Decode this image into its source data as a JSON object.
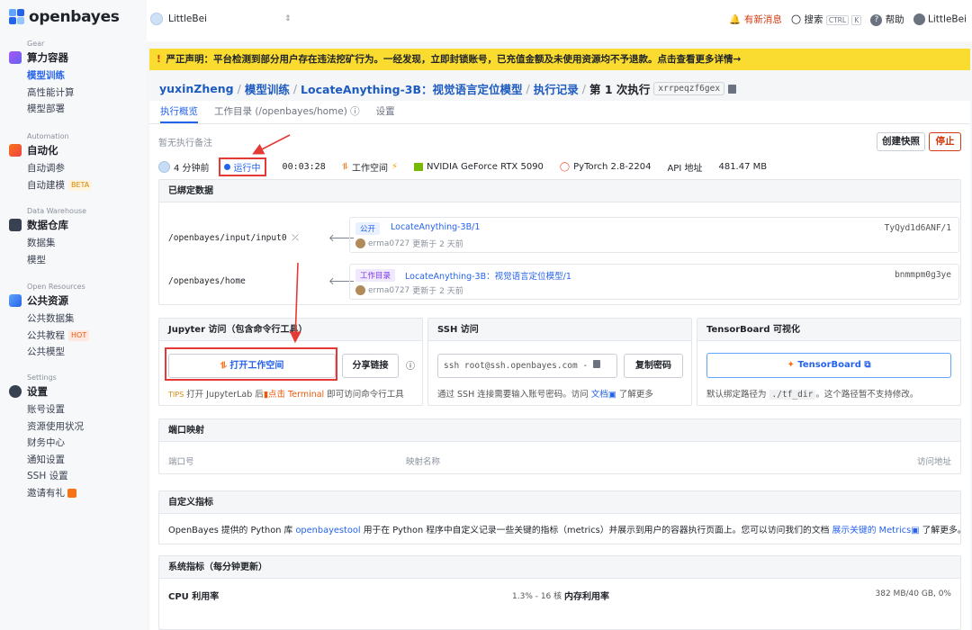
{
  "brand": {
    "name": "openbayes"
  },
  "sidebar": {
    "groups": [
      {
        "caption": "Gear",
        "title": "算力容器",
        "items": [
          "模型训练",
          "高性能计算",
          "模型部署"
        ]
      },
      {
        "caption": "Automation",
        "title": "自动化",
        "items": [
          "自动调参",
          "自动建模"
        ],
        "tag": "BETA"
      },
      {
        "caption": "Data Warehouse",
        "title": "数据仓库",
        "items": [
          "数据集",
          "模型"
        ]
      },
      {
        "caption": "Open Resources",
        "title": "公共资源",
        "items": [
          "公共数据集",
          "公共教程",
          "公共模型"
        ],
        "tag": "HOT"
      },
      {
        "caption": "Settings",
        "title": "设置",
        "items": [
          "账号设置",
          "资源使用状况",
          "财务中心",
          "通知设置",
          "SSH 设置",
          "邀请有礼"
        ]
      }
    ]
  },
  "topbar": {
    "workspace": "LittleBei",
    "news": "有新消息",
    "search": "搜索",
    "kbd_ctrl": "CTRL",
    "kbd_k": "K",
    "help": "帮助",
    "user": "LittleBei"
  },
  "banner": {
    "bang": "!",
    "text": "严正声明：平台检测到部分用户存在违法挖矿行为。一经发现，立即封锁账号，已充值金额及未使用资源均不予退款。点击查看更多详情→"
  },
  "breadcrumb": {
    "user": "yuxinZheng",
    "section": "模型训练",
    "project": "LocateAnything-3B：视觉语言定位模型",
    "records": "执行记录",
    "run": "第 1 次执行",
    "run_id": "xrrpeqzf6gex",
    "sep": "/"
  },
  "tabs": [
    "执行概览",
    "工作目录 (/openbayes/home) ⓘ",
    "设置"
  ],
  "overview": {
    "note": "暂无执行备注",
    "snapshot_btn": "创建快照",
    "stop_btn": "停止",
    "time_ago": "4 分钟前",
    "status": "运行中",
    "duration": "00:03:28",
    "workspace": "工作空间",
    "gpu": "NVIDIA GeForce RTX 5090",
    "framework": "PyTorch 2.8-2204",
    "api": "API 地址",
    "size": "481.47 MB"
  },
  "bound": {
    "title": "已绑定数据",
    "rows": [
      {
        "path": "/openbayes/input/input0",
        "badge": "公开",
        "name": "LocateAnything-3B/1",
        "user": "erma0727",
        "updated": "更新于 2 天前",
        "hash": "TyQyd1d6ANF/1"
      },
      {
        "path": "/openbayes/home",
        "badge": "工作目录",
        "name": "LocateAnything-3B：视觉语言定位模型/1",
        "user": "erma0727",
        "updated": "更新于 2 天前",
        "hash": "bnmmpm0g3ye"
      }
    ]
  },
  "jupyter": {
    "title": "Jupyter 访问（包含命令行工具）",
    "open_btn": "打开工作空间",
    "share_btn": "分享链接",
    "tips_badge": "TIPS",
    "tips_a": "打开 JupyterLab 后",
    "tips_b": "点击 Terminal",
    "tips_c": "即可访问命令行工具"
  },
  "ssh": {
    "title": "SSH 访问",
    "command": "ssh root@ssh.openbayes.com -",
    "copy_btn": "复制密码",
    "desc_a": "通过 SSH 连接需要输入账号密码。访问",
    "desc_link": "文档",
    "desc_b": "了解更多"
  },
  "tensorboard": {
    "title": "TensorBoard 可视化",
    "btn": "TensorBoard",
    "desc_a": "默认绑定路径为",
    "path": "./tf_dir",
    "desc_b": "。这个路径暂不支持修改。"
  },
  "ports": {
    "title": "端口映射",
    "cols": [
      "端口号",
      "映射名称",
      "访问地址"
    ]
  },
  "metrics": {
    "title": "自定义指标",
    "text_a": "OpenBayes 提供的 Python 库",
    "lib": "openbayestool",
    "text_b": "用于在 Python 程序中自定义记录一些关键的指标（metrics）并展示到用户的容器执行页面上。您可以访问我们的文档",
    "link": "展示关键的 Metrics",
    "text_c": "了解更多。"
  },
  "system": {
    "title": "系统指标（每分钟更新）",
    "cpu_label": "CPU 利用率",
    "cpu_value": "1.3% - 16 核",
    "mem_label": "内存利用率",
    "mem_value": "382 MB/40 GB, 0%"
  },
  "colors": {
    "accent": "#2563eb",
    "banner": "#fadc30",
    "annotation": "#e53935"
  }
}
